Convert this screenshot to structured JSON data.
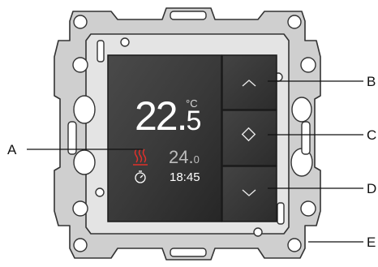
{
  "display": {
    "current_temp_whole": "22.",
    "current_temp_decimal": "5",
    "unit": "°C",
    "setpoint_whole": "24.",
    "setpoint_decimal": "0",
    "time": "18:45",
    "heating_icon": "heating-waves-icon",
    "clock_icon": "stopwatch-icon"
  },
  "buttons": {
    "up_icon": "chevron-up-icon",
    "mode_icon": "diamond-icon",
    "down_icon": "chevron-down-icon"
  },
  "callouts": {
    "a": "A",
    "b": "B",
    "c": "C",
    "d": "D",
    "e": "E"
  },
  "colors": {
    "frame": "#c9c9c9",
    "frame_edge": "#3a3a3a",
    "panel": "#3d3d3d",
    "panel_dark": "#2b2b2b",
    "heating": "#e0312b",
    "text": "#ffffff",
    "setpoint_text": "#bdbdbd"
  }
}
